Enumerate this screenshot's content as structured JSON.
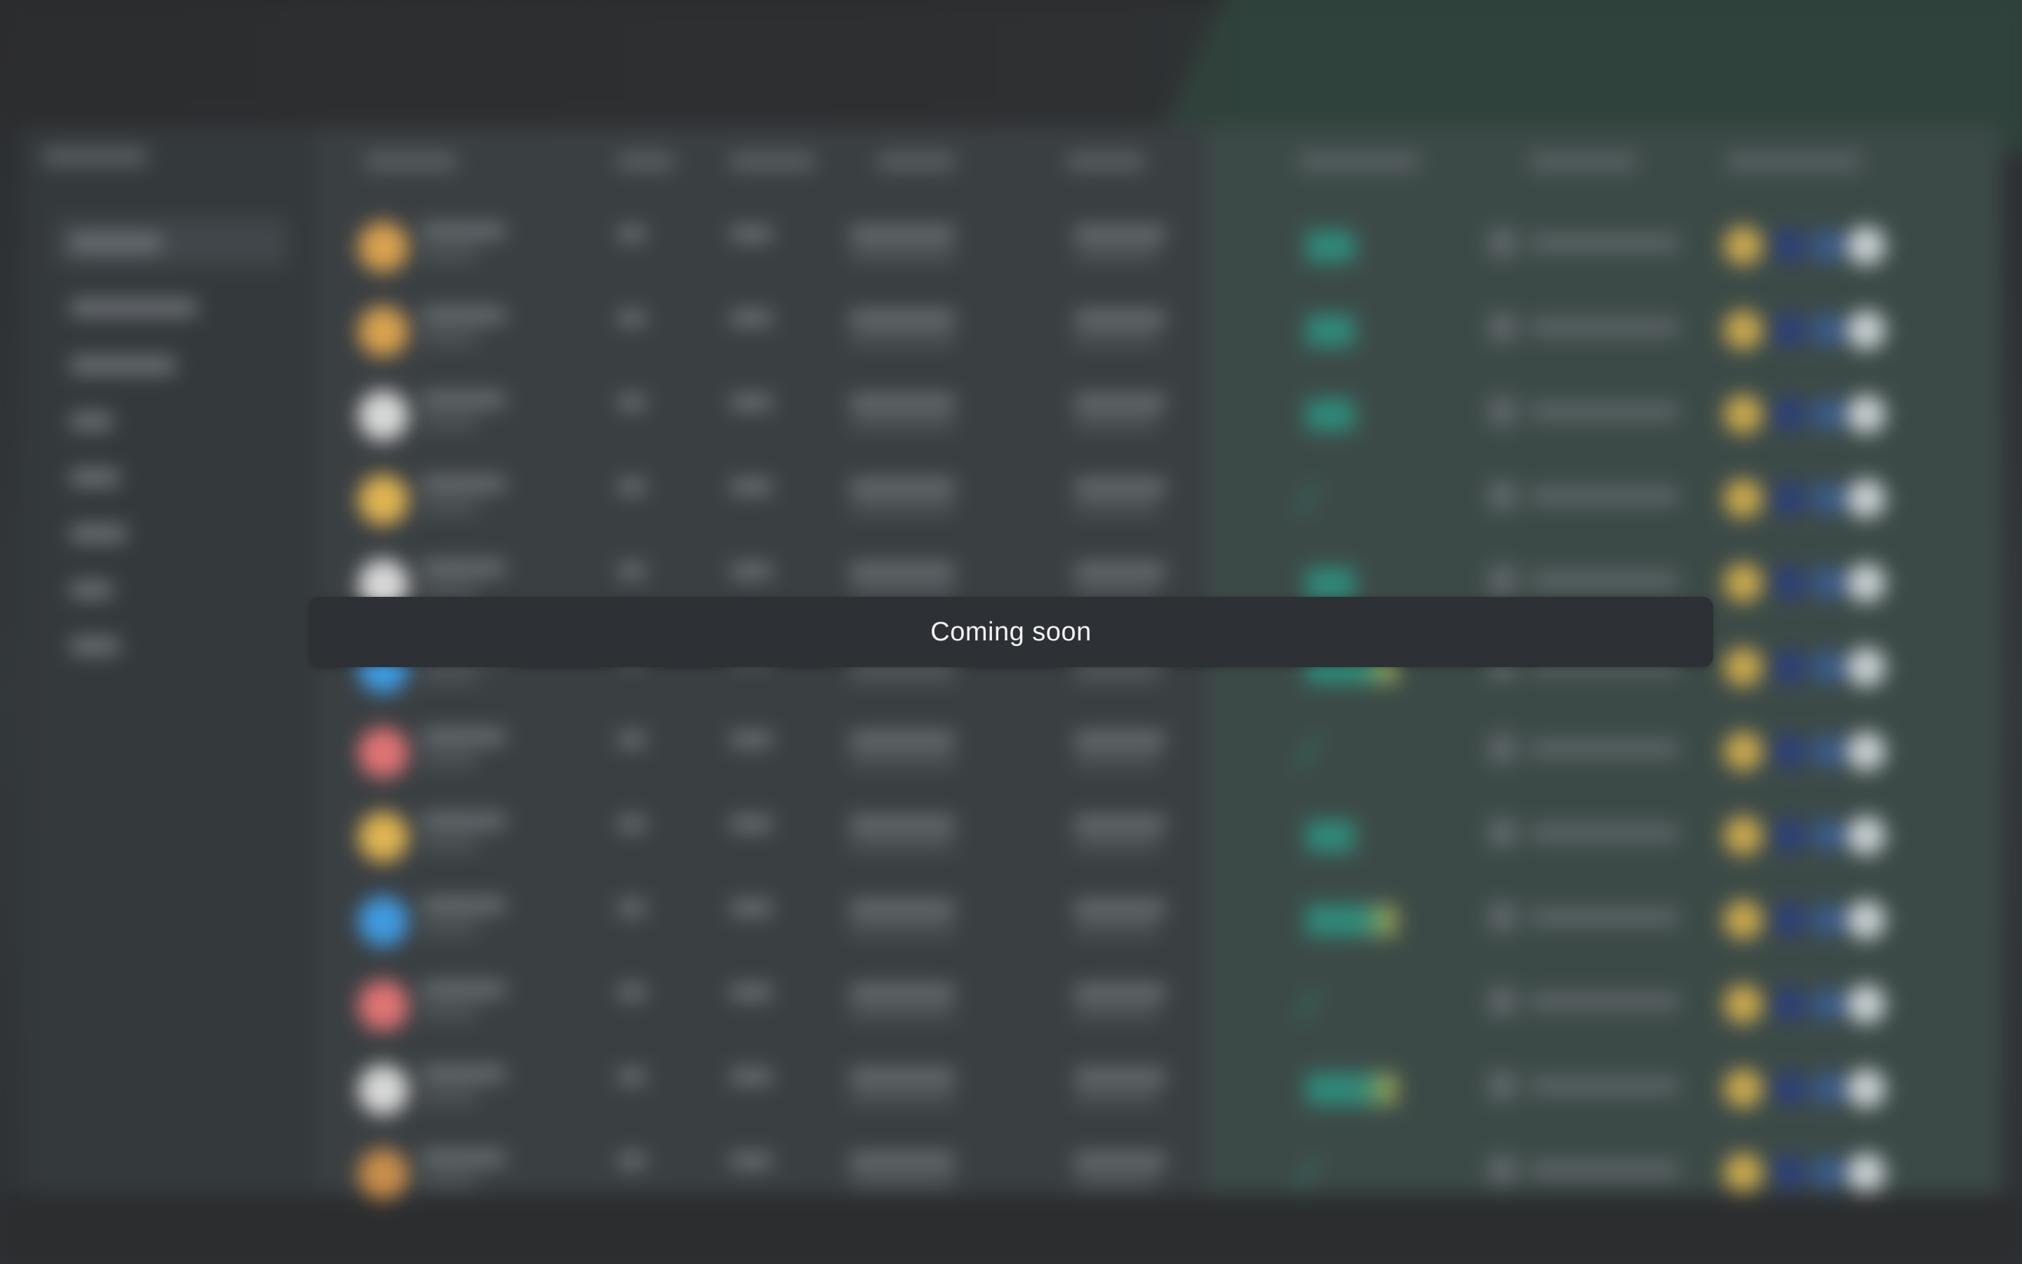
{
  "overlay": {
    "message": "Coming soon"
  },
  "background": {
    "state": "blurred",
    "rows": [
      {
        "coin_color": "#d9a24e"
      },
      {
        "coin_color": "#d9a24e"
      },
      {
        "coin_color": "#d8d8d8"
      },
      {
        "coin_color": "#e0b552"
      },
      {
        "coin_color": "#d8d8d8"
      },
      {
        "coin_color": "#3f9be0"
      },
      {
        "coin_color": "#e07474"
      },
      {
        "coin_color": "#e0b552"
      },
      {
        "coin_color": "#3f9be0"
      },
      {
        "coin_color": "#e07474"
      },
      {
        "coin_color": "#d8d8d8"
      },
      {
        "coin_color": "#c98e4a"
      }
    ]
  },
  "colors": {
    "banner_bg": "#2d3035",
    "banner_text": "#f1f2f3",
    "page_bg": "#2b2e31"
  }
}
